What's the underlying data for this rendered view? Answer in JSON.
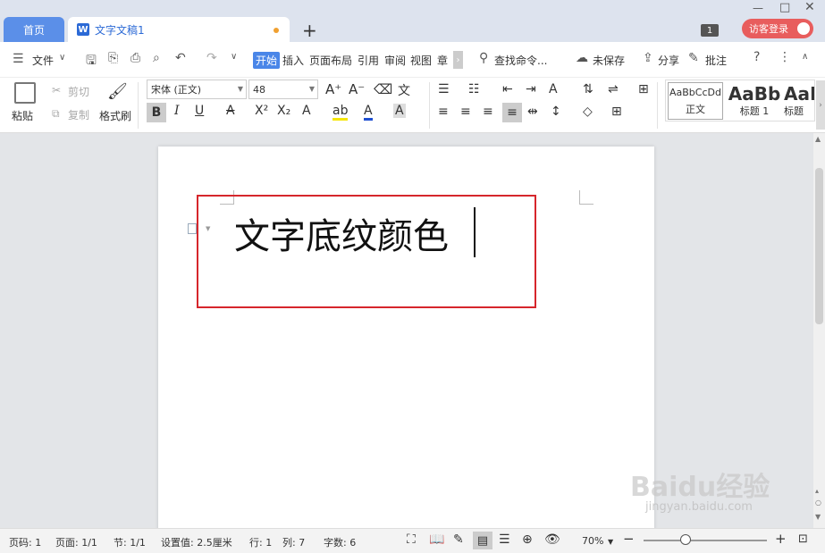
{
  "tabs": {
    "home": "首页",
    "doc": "文字文稿1",
    "doc_icon": "W"
  },
  "window": {
    "badge": "1",
    "login": "访客登录"
  },
  "menu": {
    "file": "文件",
    "start": "开始",
    "items": [
      "插入",
      "页面布局",
      "引用",
      "审阅",
      "视图",
      "章"
    ],
    "search": "查找命令...",
    "unsaved": "未保存",
    "share": "分享",
    "comment": "批注"
  },
  "toolbar": {
    "paste": "粘贴",
    "cut": "剪切",
    "copy": "复制",
    "format_painter": "格式刷",
    "font": "宋体 (正文)",
    "size": "48"
  },
  "styles": [
    {
      "preview": "AaBbCcDd",
      "label": "正文"
    },
    {
      "preview": "AaBb",
      "label": "标题 1"
    },
    {
      "preview": "AaI",
      "label": "标题"
    }
  ],
  "document": {
    "text": "文字底纹颜色"
  },
  "status": {
    "page_num": "页码: 1",
    "pages": "页面: 1/1",
    "section": "节: 1/1",
    "setting": "设置值: 2.5厘米",
    "row": "行: 1",
    "col": "列: 7",
    "words": "字数: 6",
    "zoom": "70%"
  },
  "watermark": {
    "main": "Baidu经验",
    "sub": "jingyan.baidu.com"
  },
  "colors": {
    "accent": "#4a86e8",
    "home_tab": "#5b8fe8",
    "login": "#e85d5d",
    "highlight": "#d6262c"
  }
}
